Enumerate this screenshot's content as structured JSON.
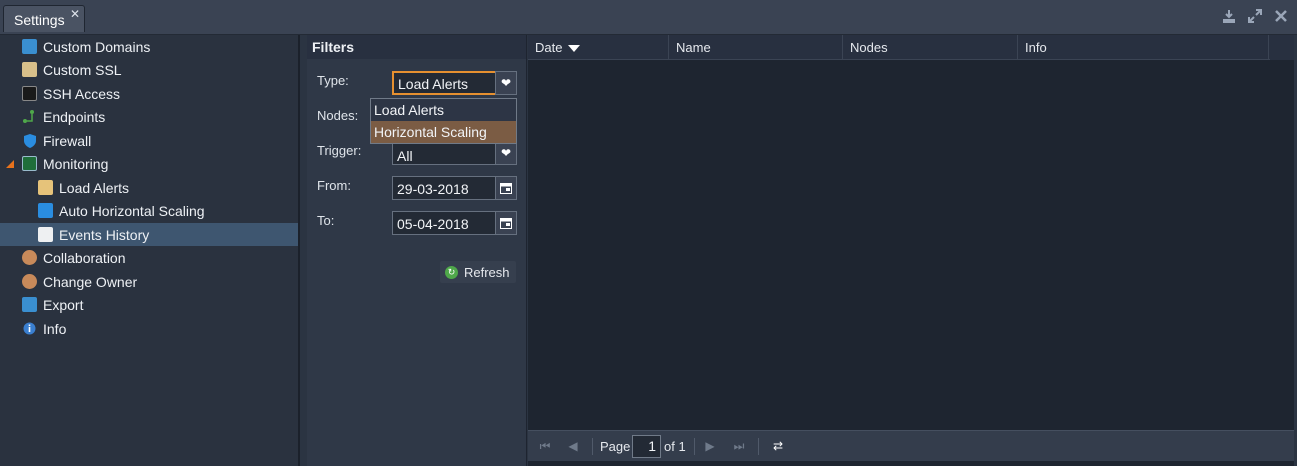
{
  "tab": {
    "title": "Settings",
    "close": "✕"
  },
  "window_icons": [
    "download-icon",
    "expand-icon",
    "close-icon"
  ],
  "sidebar": {
    "items": [
      {
        "label": "Custom Domains",
        "icon": "domains-icon"
      },
      {
        "label": "Custom SSL",
        "icon": "ssl-icon"
      },
      {
        "label": "SSH Access",
        "icon": "terminal-icon"
      },
      {
        "label": "Endpoints",
        "icon": "endpoints-icon"
      },
      {
        "label": "Firewall",
        "icon": "shield-icon"
      },
      {
        "label": "Monitoring",
        "icon": "monitoring-icon"
      },
      {
        "label": "Load Alerts",
        "icon": "mail-alert-icon"
      },
      {
        "label": "Auto Horizontal Scaling",
        "icon": "scaling-icon"
      },
      {
        "label": "Events History",
        "icon": "document-icon"
      },
      {
        "label": "Collaboration",
        "icon": "users-icon"
      },
      {
        "label": "Change Owner",
        "icon": "change-owner-icon"
      },
      {
        "label": "Export",
        "icon": "export-icon"
      },
      {
        "label": "Info",
        "icon": "info-icon"
      }
    ],
    "selected": "Events History"
  },
  "filters": {
    "title": "Filters",
    "type_label": "Type:",
    "type_value": "Load Alerts",
    "nodes_label": "Nodes:",
    "trigger_label": "Trigger:",
    "trigger_value": "All",
    "from_label": "From:",
    "from_value": "29-03-2018",
    "to_label": "To:",
    "to_value": "05-04-2018",
    "refresh_label": "Refresh",
    "type_options": [
      "Load Alerts",
      "Horizontal Scaling"
    ],
    "type_hovered": "Horizontal Scaling"
  },
  "grid": {
    "columns": [
      "Date",
      "Name",
      "Nodes",
      "Info"
    ],
    "sort_column": "Date"
  },
  "pager": {
    "page_label": "Page",
    "page_value": "1",
    "of_label": "of 1"
  },
  "colors": {
    "accent": "#e69030",
    "selected_row": "#3e5670",
    "dropdown_hover": "#7b5c44"
  }
}
